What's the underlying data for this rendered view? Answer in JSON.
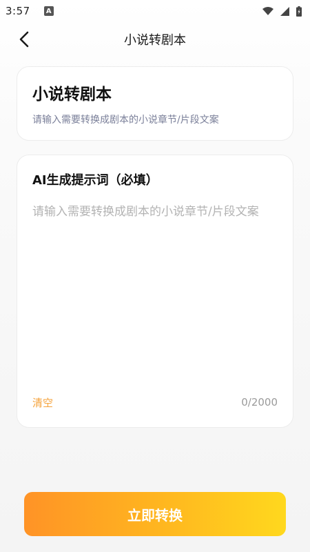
{
  "status_bar": {
    "time": "3:57",
    "app_icon": "A",
    "icons": [
      "wifi-icon",
      "signal-icon",
      "battery-icon"
    ]
  },
  "nav": {
    "back_icon": "chevron-left-icon",
    "title": "小说转剧本"
  },
  "info_card": {
    "title": "小说转剧本",
    "subtitle": "请输入需要转换成剧本的小说章节/片段文案"
  },
  "prompt_card": {
    "label": "AI生成提示词（必填）",
    "value": "",
    "placeholder": "请输入需要转换成剧本的小说章节/片段文案",
    "clear_label": "清空",
    "counter": "0/2000"
  },
  "actions": {
    "convert_label": "立即转换"
  },
  "colors": {
    "accent_orange": "#f5a23a",
    "button_gradient_start": "#ff9326",
    "button_gradient_end": "#ffd81e",
    "subtitle_text": "#7a7f99"
  }
}
